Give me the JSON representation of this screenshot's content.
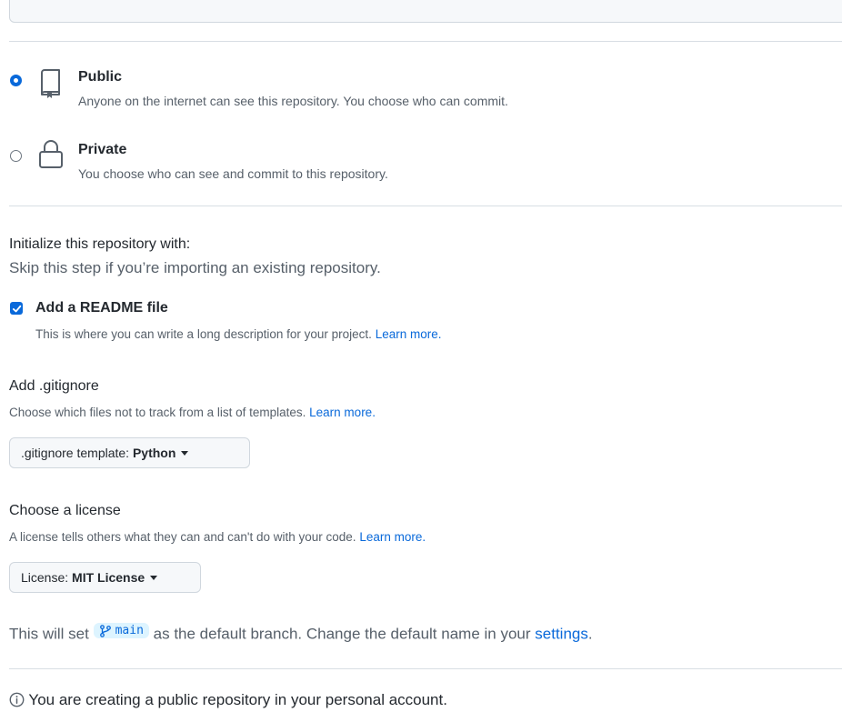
{
  "visibility": {
    "public": {
      "label": "Public",
      "description": "Anyone on the internet can see this repository. You choose who can commit.",
      "selected": true
    },
    "private": {
      "label": "Private",
      "description": "You choose who can see and commit to this repository.",
      "selected": false
    }
  },
  "initialize": {
    "title": "Initialize this repository with:",
    "subtitle": "Skip this step if you’re importing an existing repository.",
    "readme": {
      "label": "Add a README file",
      "description": "This is where you can write a long description for your project.",
      "link": "Learn more.",
      "checked": true
    }
  },
  "gitignore": {
    "title": "Add .gitignore",
    "description": "Choose which files not to track from a list of templates.",
    "link": "Learn more.",
    "button_prefix": ".gitignore template: ",
    "button_value": "Python"
  },
  "license": {
    "title": "Choose a license",
    "description": "A license tells others what they can and can't do with your code.",
    "link": "Learn more.",
    "button_prefix": "License: ",
    "button_value": "MIT License"
  },
  "branch": {
    "prefix": "This will set",
    "name": "main",
    "middle": "as the default branch. Change the default name in your",
    "link": "settings",
    "suffix": "."
  },
  "info": {
    "text": "You are creating a public repository in your personal account."
  },
  "colors": {
    "accent": "#0969da",
    "muted_text": "#57606a",
    "border": "#d0d7de"
  }
}
